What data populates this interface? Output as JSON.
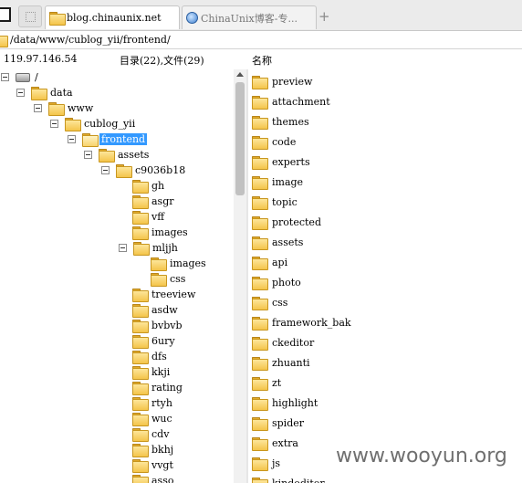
{
  "tabs": [
    {
      "label": "blog.chinaunix.net",
      "active": true
    },
    {
      "label": "ChinaUnix博客-专...",
      "active": false
    }
  ],
  "new_tab_label": "+",
  "path": "/data/www/cublog_yii/frontend/",
  "info": {
    "ip": "119.97.146.54",
    "counts": "目录(22),文件(29)",
    "column_name": "名称"
  },
  "tree": [
    {
      "label": "/",
      "icon": "drive-icon",
      "toggle": true
    },
    {
      "label": "data",
      "icon": "folder-icon",
      "toggle": true
    },
    {
      "label": "www",
      "icon": "folder-icon",
      "toggle": true
    },
    {
      "label": "cublog_yii",
      "icon": "folder-icon",
      "toggle": true
    },
    {
      "label": "frontend",
      "icon": "folder-open-icon",
      "toggle": true,
      "selected": true
    },
    {
      "label": "assets",
      "icon": "folder-icon",
      "toggle": true
    },
    {
      "label": "c9036b18",
      "icon": "folder-icon",
      "toggle": true
    },
    {
      "label": "gh",
      "icon": "folder-icon",
      "toggle": false
    },
    {
      "label": "asgr",
      "icon": "folder-icon",
      "toggle": false
    },
    {
      "label": "vff",
      "icon": "folder-icon",
      "toggle": false
    },
    {
      "label": "images",
      "icon": "folder-icon",
      "toggle": false
    },
    {
      "label": "mljjh",
      "icon": "folder-icon",
      "toggle": true
    },
    {
      "label": "images",
      "icon": "folder-icon",
      "toggle": false
    },
    {
      "label": "css",
      "icon": "folder-icon",
      "toggle": false
    },
    {
      "label": "treeview",
      "icon": "folder-icon",
      "toggle": false
    },
    {
      "label": "asdw",
      "icon": "folder-icon",
      "toggle": false
    },
    {
      "label": "bvbvb",
      "icon": "folder-icon",
      "toggle": false
    },
    {
      "label": "6ury",
      "icon": "folder-icon",
      "toggle": false
    },
    {
      "label": "dfs",
      "icon": "folder-icon",
      "toggle": false
    },
    {
      "label": "kkji",
      "icon": "folder-icon",
      "toggle": false
    },
    {
      "label": "rating",
      "icon": "folder-icon",
      "toggle": false
    },
    {
      "label": "rtyh",
      "icon": "folder-icon",
      "toggle": false
    },
    {
      "label": "wuc",
      "icon": "folder-icon",
      "toggle": false
    },
    {
      "label": "cdv",
      "icon": "folder-icon",
      "toggle": false
    },
    {
      "label": "bkhj",
      "icon": "folder-icon",
      "toggle": false
    },
    {
      "label": "vvgt",
      "icon": "folder-icon",
      "toggle": false
    },
    {
      "label": "asso",
      "icon": "folder-icon",
      "toggle": false
    }
  ],
  "list": [
    "preview",
    "attachment",
    "themes",
    "code",
    "experts",
    "image",
    "topic",
    "protected",
    "assets",
    "api",
    "photo",
    "css",
    "framework_bak",
    "ckeditor",
    "zhuanti",
    "zt",
    "highlight",
    "spider",
    "extra",
    "js",
    "kindeditor"
  ],
  "watermark": "www.wooyun.org"
}
